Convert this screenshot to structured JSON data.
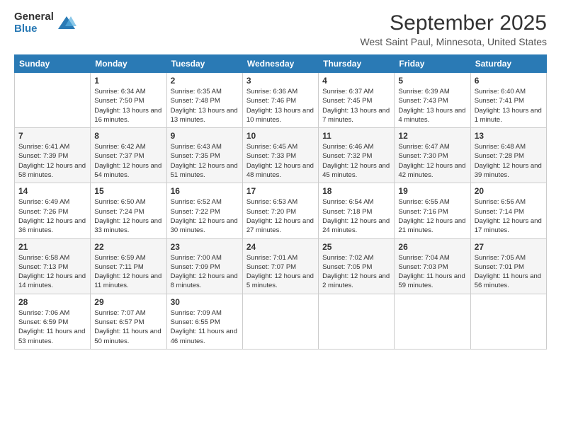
{
  "logo": {
    "general": "General",
    "blue": "Blue"
  },
  "header": {
    "title": "September 2025",
    "location": "West Saint Paul, Minnesota, United States"
  },
  "weekdays": [
    "Sunday",
    "Monday",
    "Tuesday",
    "Wednesday",
    "Thursday",
    "Friday",
    "Saturday"
  ],
  "weeks": [
    [
      {
        "day": "",
        "sunrise": "",
        "sunset": "",
        "daylight": ""
      },
      {
        "day": "1",
        "sunrise": "Sunrise: 6:34 AM",
        "sunset": "Sunset: 7:50 PM",
        "daylight": "Daylight: 13 hours and 16 minutes."
      },
      {
        "day": "2",
        "sunrise": "Sunrise: 6:35 AM",
        "sunset": "Sunset: 7:48 PM",
        "daylight": "Daylight: 13 hours and 13 minutes."
      },
      {
        "day": "3",
        "sunrise": "Sunrise: 6:36 AM",
        "sunset": "Sunset: 7:46 PM",
        "daylight": "Daylight: 13 hours and 10 minutes."
      },
      {
        "day": "4",
        "sunrise": "Sunrise: 6:37 AM",
        "sunset": "Sunset: 7:45 PM",
        "daylight": "Daylight: 13 hours and 7 minutes."
      },
      {
        "day": "5",
        "sunrise": "Sunrise: 6:39 AM",
        "sunset": "Sunset: 7:43 PM",
        "daylight": "Daylight: 13 hours and 4 minutes."
      },
      {
        "day": "6",
        "sunrise": "Sunrise: 6:40 AM",
        "sunset": "Sunset: 7:41 PM",
        "daylight": "Daylight: 13 hours and 1 minute."
      }
    ],
    [
      {
        "day": "7",
        "sunrise": "Sunrise: 6:41 AM",
        "sunset": "Sunset: 7:39 PM",
        "daylight": "Daylight: 12 hours and 58 minutes."
      },
      {
        "day": "8",
        "sunrise": "Sunrise: 6:42 AM",
        "sunset": "Sunset: 7:37 PM",
        "daylight": "Daylight: 12 hours and 54 minutes."
      },
      {
        "day": "9",
        "sunrise": "Sunrise: 6:43 AM",
        "sunset": "Sunset: 7:35 PM",
        "daylight": "Daylight: 12 hours and 51 minutes."
      },
      {
        "day": "10",
        "sunrise": "Sunrise: 6:45 AM",
        "sunset": "Sunset: 7:33 PM",
        "daylight": "Daylight: 12 hours and 48 minutes."
      },
      {
        "day": "11",
        "sunrise": "Sunrise: 6:46 AM",
        "sunset": "Sunset: 7:32 PM",
        "daylight": "Daylight: 12 hours and 45 minutes."
      },
      {
        "day": "12",
        "sunrise": "Sunrise: 6:47 AM",
        "sunset": "Sunset: 7:30 PM",
        "daylight": "Daylight: 12 hours and 42 minutes."
      },
      {
        "day": "13",
        "sunrise": "Sunrise: 6:48 AM",
        "sunset": "Sunset: 7:28 PM",
        "daylight": "Daylight: 12 hours and 39 minutes."
      }
    ],
    [
      {
        "day": "14",
        "sunrise": "Sunrise: 6:49 AM",
        "sunset": "Sunset: 7:26 PM",
        "daylight": "Daylight: 12 hours and 36 minutes."
      },
      {
        "day": "15",
        "sunrise": "Sunrise: 6:50 AM",
        "sunset": "Sunset: 7:24 PM",
        "daylight": "Daylight: 12 hours and 33 minutes."
      },
      {
        "day": "16",
        "sunrise": "Sunrise: 6:52 AM",
        "sunset": "Sunset: 7:22 PM",
        "daylight": "Daylight: 12 hours and 30 minutes."
      },
      {
        "day": "17",
        "sunrise": "Sunrise: 6:53 AM",
        "sunset": "Sunset: 7:20 PM",
        "daylight": "Daylight: 12 hours and 27 minutes."
      },
      {
        "day": "18",
        "sunrise": "Sunrise: 6:54 AM",
        "sunset": "Sunset: 7:18 PM",
        "daylight": "Daylight: 12 hours and 24 minutes."
      },
      {
        "day": "19",
        "sunrise": "Sunrise: 6:55 AM",
        "sunset": "Sunset: 7:16 PM",
        "daylight": "Daylight: 12 hours and 21 minutes."
      },
      {
        "day": "20",
        "sunrise": "Sunrise: 6:56 AM",
        "sunset": "Sunset: 7:14 PM",
        "daylight": "Daylight: 12 hours and 17 minutes."
      }
    ],
    [
      {
        "day": "21",
        "sunrise": "Sunrise: 6:58 AM",
        "sunset": "Sunset: 7:13 PM",
        "daylight": "Daylight: 12 hours and 14 minutes."
      },
      {
        "day": "22",
        "sunrise": "Sunrise: 6:59 AM",
        "sunset": "Sunset: 7:11 PM",
        "daylight": "Daylight: 12 hours and 11 minutes."
      },
      {
        "day": "23",
        "sunrise": "Sunrise: 7:00 AM",
        "sunset": "Sunset: 7:09 PM",
        "daylight": "Daylight: 12 hours and 8 minutes."
      },
      {
        "day": "24",
        "sunrise": "Sunrise: 7:01 AM",
        "sunset": "Sunset: 7:07 PM",
        "daylight": "Daylight: 12 hours and 5 minutes."
      },
      {
        "day": "25",
        "sunrise": "Sunrise: 7:02 AM",
        "sunset": "Sunset: 7:05 PM",
        "daylight": "Daylight: 12 hours and 2 minutes."
      },
      {
        "day": "26",
        "sunrise": "Sunrise: 7:04 AM",
        "sunset": "Sunset: 7:03 PM",
        "daylight": "Daylight: 11 hours and 59 minutes."
      },
      {
        "day": "27",
        "sunrise": "Sunrise: 7:05 AM",
        "sunset": "Sunset: 7:01 PM",
        "daylight": "Daylight: 11 hours and 56 minutes."
      }
    ],
    [
      {
        "day": "28",
        "sunrise": "Sunrise: 7:06 AM",
        "sunset": "Sunset: 6:59 PM",
        "daylight": "Daylight: 11 hours and 53 minutes."
      },
      {
        "day": "29",
        "sunrise": "Sunrise: 7:07 AM",
        "sunset": "Sunset: 6:57 PM",
        "daylight": "Daylight: 11 hours and 50 minutes."
      },
      {
        "day": "30",
        "sunrise": "Sunrise: 7:09 AM",
        "sunset": "Sunset: 6:55 PM",
        "daylight": "Daylight: 11 hours and 46 minutes."
      },
      {
        "day": "",
        "sunrise": "",
        "sunset": "",
        "daylight": ""
      },
      {
        "day": "",
        "sunrise": "",
        "sunset": "",
        "daylight": ""
      },
      {
        "day": "",
        "sunrise": "",
        "sunset": "",
        "daylight": ""
      },
      {
        "day": "",
        "sunrise": "",
        "sunset": "",
        "daylight": ""
      }
    ]
  ]
}
